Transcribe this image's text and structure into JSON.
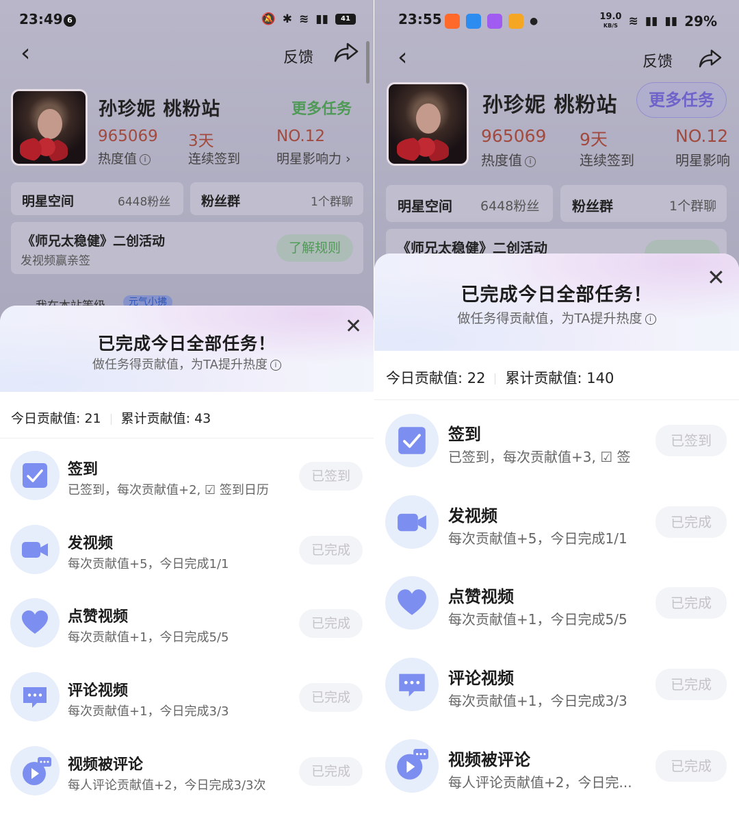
{
  "left": {
    "status": {
      "time": "23:49",
      "notif_badge": "6",
      "battery": "41"
    },
    "nav": {
      "feedback": "反馈"
    },
    "profile": {
      "name": "孙珍妮 桃粉站",
      "more_tasks": "更多任务",
      "stats": [
        {
          "value": "965069",
          "label": "热度值"
        },
        {
          "value": "3天",
          "label": "连续签到"
        },
        {
          "value": "NO.12",
          "label": "明星影响力 ›"
        }
      ]
    },
    "cards": {
      "space_title": "明星空间",
      "space_count": "6448粉丝",
      "group_title": "粉丝群",
      "group_count": "1个群聊",
      "activity_title": "《师兄太稳健》二创活动",
      "activity_sub": "发视频赢亲签",
      "activity_btn": "了解规则"
    },
    "peek": "我在本站等级",
    "peek_badge": "元气小拂",
    "sheet": {
      "title": "已完成今日全部任务！",
      "subtitle": "做任务得贡献值，为TA提升热度",
      "today": "今日贡献值: 21",
      "total": "累计贡献值: 43",
      "tasks": [
        {
          "name": "签到",
          "desc": "已签到，每次贡献值+2, ☑ 签到日历",
          "button": "已签到",
          "icon": "check-icon"
        },
        {
          "name": "发视频",
          "desc": "每次贡献值+5，今日完成1/1",
          "button": "已完成",
          "icon": "video-camera-icon"
        },
        {
          "name": "点赞视频",
          "desc": "每次贡献值+1，今日完成5/5",
          "button": "已完成",
          "icon": "heart-icon"
        },
        {
          "name": "评论视频",
          "desc": "每次贡献值+1，今日完成3/3",
          "button": "已完成",
          "icon": "comment-icon"
        },
        {
          "name": "视频被评论",
          "desc": "每人评论贡献值+2，今日完成3/3次",
          "button": "已完成",
          "icon": "play-comment-icon"
        }
      ]
    }
  },
  "right": {
    "status": {
      "time": "23:55",
      "speed": "19.0",
      "speed_unit": "KB/S",
      "battery": "29%"
    },
    "nav": {
      "feedback": "反馈"
    },
    "profile": {
      "name": "孙珍妮 桃粉站",
      "more_tasks": "更多任务",
      "stats": [
        {
          "value": "965069",
          "label": "热度值"
        },
        {
          "value": "9天",
          "label": "连续签到"
        },
        {
          "value": "NO.12",
          "label": "明星影响"
        }
      ]
    },
    "cards": {
      "space_title": "明星空间",
      "space_count": "6448粉丝",
      "group_title": "粉丝群",
      "group_count": "1个群聊",
      "activity_title": "《师兄太稳健》二创活动"
    },
    "sheet": {
      "title": "已完成今日全部任务！",
      "subtitle": "做任务得贡献值，为TA提升热度",
      "today": "今日贡献值: 22",
      "total": "累计贡献值: 140",
      "tasks": [
        {
          "name": "签到",
          "desc": "已签到，每次贡献值+3, ☑ 签",
          "button": "已签到",
          "icon": "check-icon"
        },
        {
          "name": "发视频",
          "desc": "每次贡献值+5，今日完成1/1",
          "button": "已完成",
          "icon": "video-camera-icon"
        },
        {
          "name": "点赞视频",
          "desc": "每次贡献值+1，今日完成5/5",
          "button": "已完成",
          "icon": "heart-icon"
        },
        {
          "name": "评论视频",
          "desc": "每次贡献值+1，今日完成3/3",
          "button": "已完成",
          "icon": "comment-icon"
        },
        {
          "name": "视频被评论",
          "desc": "每人评论贡献值+2，今日完...",
          "button": "已完成",
          "icon": "play-comment-icon"
        }
      ]
    }
  },
  "colors": {
    "accent_green": "#4e9a56",
    "more_tasks_purple": "#6f63c9",
    "stat_red": "#a14a3f",
    "icon_blue": "#7c8ef0"
  }
}
